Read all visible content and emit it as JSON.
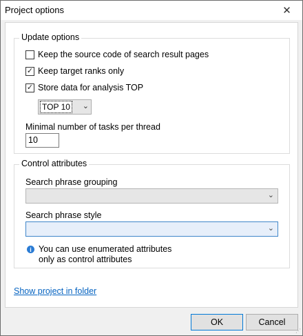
{
  "window": {
    "title": "Project options",
    "close_glyph": "✕"
  },
  "update_options": {
    "legend": "Update options",
    "keep_source": {
      "label": "Keep the source code of search result pages",
      "checked": false
    },
    "keep_target": {
      "label": "Keep target ranks only",
      "checked": true
    },
    "store_data": {
      "label": "Store data for analysis TOP",
      "checked": true
    },
    "top_select": {
      "value": "TOP 10"
    },
    "min_tasks_label": "Minimal number of tasks per thread",
    "min_tasks_value": "10"
  },
  "control_attributes": {
    "legend": "Control attributes",
    "grouping_label": "Search phrase grouping",
    "grouping_value": "",
    "style_label": "Search phrase style",
    "style_value": "",
    "info_line1": "You can use enumerated attributes",
    "info_line2": "only as control attributes"
  },
  "footer": {
    "show_folder_link": "Show project in folder",
    "ok_label": "OK",
    "cancel_label": "Cancel"
  },
  "colors": {
    "accent": "#0078d7",
    "link": "#0563c1",
    "info": "#2a7bd4"
  }
}
